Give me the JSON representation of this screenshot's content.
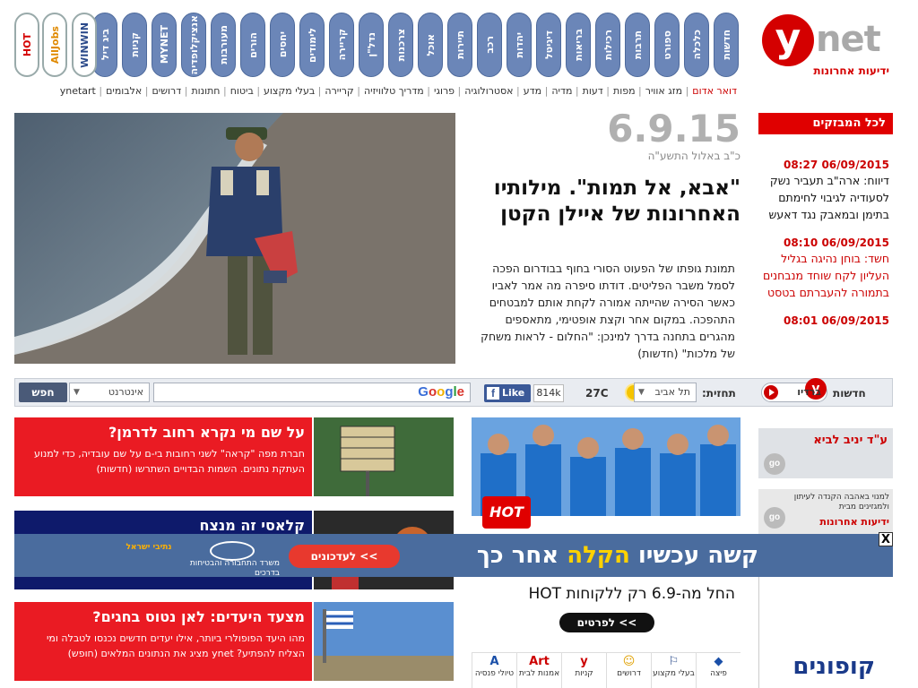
{
  "brand": {
    "logo_letter": "y",
    "logo_word": "net",
    "tagline": "ידיעות אחרונות"
  },
  "nav": {
    "pills": [
      "חדשות",
      "כלכלה",
      "ספורט",
      "תרבות",
      "רכילות",
      "בריאות",
      "דיגיטל",
      "יהדות",
      "רכב",
      "תיירות",
      "אוכל",
      "צרכנות",
      "נדל\"ן",
      "קריירה",
      "לימודים",
      "יחסים",
      "הורים",
      "מעורבות",
      "אנציקלופדיה",
      "MYNET",
      "קניות",
      "ביג דיל"
    ],
    "partner_pills": [
      "WINWIN",
      "AllJobs",
      "HOT"
    ],
    "sub_links": [
      {
        "label": "דואר אדום",
        "red": true
      },
      {
        "label": "מזג אוויר"
      },
      {
        "label": "מפות"
      },
      {
        "label": "דעות"
      },
      {
        "label": "מדיה"
      },
      {
        "label": "מדע"
      },
      {
        "label": "אסטרולוגיה"
      },
      {
        "label": "פרוגי"
      },
      {
        "label": "מדריך טלוויזיה"
      },
      {
        "label": "קריירה"
      },
      {
        "label": "בעלי מקצוע"
      },
      {
        "label": "ביטוח"
      },
      {
        "label": "חתונות"
      },
      {
        "label": "דרושים"
      },
      {
        "label": "אלבומים"
      },
      {
        "label": "ynetart"
      }
    ]
  },
  "hero": {
    "date": "6.9.15",
    "hebrew_date": "כ\"ב באלול התשע\"ה",
    "title": "\"אבא, אל תמות\". מילותיו האחרונות של איילן הקטן",
    "body": "תמונת גופתו של הפעוט הסורי בחוף בבודרום הפכה לסמל משבר הפליטים. דודתו סיפרה מה אמר לאביו כאשר הסירה שהייתה אמורה לקחת אותם למבטחים התהפכה. במקום אחר וקצת אופטימי, מתאספים מהגרים בתחנה בדרך למינכן: \"החלום - לראות משחק של מלכות\" (חדשות)"
  },
  "flash": {
    "header": "לכל המבזקים",
    "items": [
      {
        "time": "06/09/2015 08:27",
        "text": "דיווח: ארה\"ב תעביר נשק לסעודיה לגיבוי לחימתם בתימן ובמאבק נגד דאעש",
        "red": false
      },
      {
        "time": "06/09/2015 08:10",
        "text": "חשד: בוחן נהיגה בגליל העליון לקח שוחד מנבחנים בתמורה להעברתם בטסט",
        "red": true
      },
      {
        "time": "06/09/2015 08:01",
        "text": "",
        "red": false
      }
    ]
  },
  "toolbar": {
    "search_btn": "חפש",
    "scope": "אינטרנט",
    "google": "Google",
    "like": "Like",
    "like_count": "814k",
    "temp": "27C",
    "city": "תל אביב",
    "forecast_label": "תחזית:",
    "radio": "ברדיו",
    "radio_y": "y",
    "radio_net": "net",
    "news_label": "חדשות"
  },
  "teasers": [
    {
      "title": "על שם מי נקרא רחוב לדרמן?",
      "body": "חברת מפה \"קראה\" לשני רחובות בי-ם על שם עובדיה, כדי למנוע העתקת נתונים. השמות הבדויים השתרשו (חדשות)",
      "style": "red"
    },
    {
      "title": "קלאסי זה מנצח",
      "body": "",
      "style": "navy"
    },
    {
      "title": "מצעד היעדים: לאן נטוס בחגים?",
      "body": "מהו היעד הפופולרי ביותר, אילו יעדים חדשים נכנסו לטבלה ומי הצליח להפתיע? ynet מציג את הנתונים המלאים (חופש)",
      "style": "red"
    }
  ],
  "hot_ad": {
    "logo": "HOT",
    "line2": "החל מה-6.9 רק ללקוחות HOT",
    "cta": "לפרטים <<",
    "icons": [
      {
        "glyph": "A",
        "label": "טיולי פנסיה"
      },
      {
        "glyph": "Art",
        "label": "אמנות לבית"
      },
      {
        "glyph": "y",
        "label": "קניות"
      },
      {
        "glyph": "☺",
        "label": "דרושים"
      },
      {
        "glyph": "⚐",
        "label": "בעלי מקצוע"
      },
      {
        "glyph": "◆",
        "label": "פיצה"
      }
    ]
  },
  "right_tiles": {
    "tile1": "ע\"ד יניב לביא",
    "tile2_top": "למנוי באהבה הקנדה לעיתון ולמגזינים מבית",
    "tile2_brand": "ידיעות אחרונות",
    "tile3": "קופונים",
    "go": "go"
  },
  "banner": {
    "msg_pre": "קשה עכשיו",
    "msg_hl": "הקלה",
    "msg_post": "אחר כך",
    "cta": "לעדכונים <<",
    "ministry": "משרד התחבורה והבטיחות בדרכים",
    "gov": "נתיבי ישראל",
    "close": "X"
  }
}
